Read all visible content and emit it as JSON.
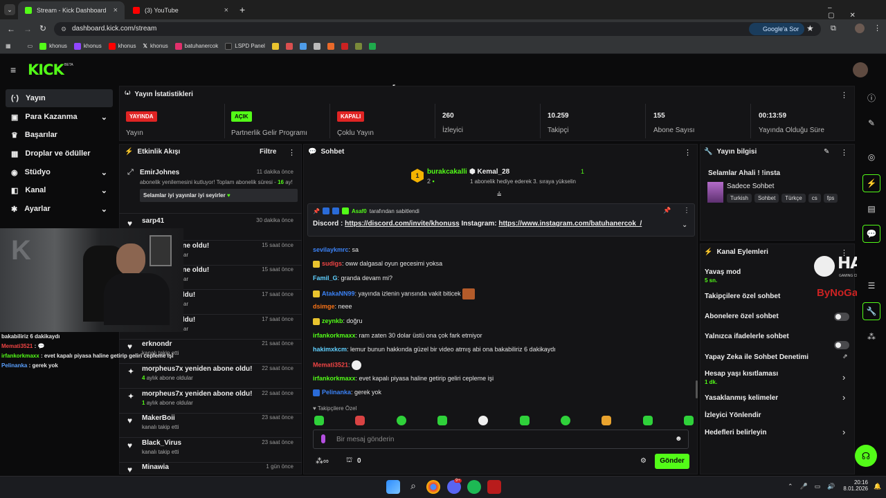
{
  "browser": {
    "tabs": [
      {
        "title": "Stream - Kick Dashboard"
      },
      {
        "title": "(3) YouTube"
      }
    ],
    "url": "dashboard.kick.com/stream",
    "google_btn": "Google'a Sor",
    "bookmarks": [
      "khonus",
      "khonus",
      "khonus",
      "khonus",
      "batuhanercok",
      "LSPD Panel"
    ]
  },
  "header": {
    "logo": "KICK",
    "beta": "BETA"
  },
  "sidebar": {
    "items": [
      {
        "label": "Yayın",
        "icon": "(·)"
      },
      {
        "label": "Para Kazanma",
        "icon": "▣"
      },
      {
        "label": "Başarılar",
        "icon": "♛"
      },
      {
        "label": "Droplar ve ödüller",
        "icon": "▦"
      },
      {
        "label": "Stüdyo",
        "icon": "◉"
      },
      {
        "label": "Kanal",
        "icon": "◧"
      },
      {
        "label": "Ayarlar",
        "icon": "✱"
      }
    ]
  },
  "stats": {
    "title": "Yayın İstatistikleri",
    "cells": [
      {
        "badge": "YAYINDA",
        "label": "Yayın"
      },
      {
        "badge": "AÇIK",
        "label": "Partnerlik Gelir Programı"
      },
      {
        "badge": "KAPALI",
        "label": "Çoklu Yayın"
      },
      {
        "value": "260",
        "label": "İzleyici"
      },
      {
        "value": "10.259",
        "label": "Takipçi"
      },
      {
        "value": "155",
        "label": "Abone Sayısı"
      },
      {
        "value": "00:13:59",
        "label": "Yayında Olduğu Süre"
      }
    ]
  },
  "feed": {
    "title": "Etkinlik Akışı",
    "filter": "Filtre",
    "first": {
      "name": "EmirJohnes",
      "time": "11 dakika önce",
      "text1": "abonelik yenilemesini kutluyor! Toplam abonelik süresi -",
      "months": "16",
      "text2": "ay!",
      "quote": "Selamlar iyi yayınlar iyi seyirler"
    },
    "items": [
      {
        "title": "sarp41",
        "sub": "",
        "time": "30 dakika önce"
      },
      {
        "title": "yeniden abone oldu!",
        "sub": "aylık abone oldular",
        "time": "15 saat önce"
      },
      {
        "title": "yeniden abone oldu!",
        "sub": "aylık abone oldular",
        "time": "15 saat önce"
      },
      {
        "title": "den abone oldu!",
        "sub": "aylık abone oldular",
        "time": "17 saat önce"
      },
      {
        "title": "den abone oldu!",
        "sub": "aylık abone oldular",
        "time": "17 saat önce"
      },
      {
        "title": "erknondr",
        "sub": "kanalı takip etti",
        "time": "21 saat önce"
      },
      {
        "title": "morpheus7x yeniden abone oldu!",
        "sub": "aylık abone oldular",
        "months": "4",
        "time": "22 saat önce"
      },
      {
        "title": "morpheus7x yeniden abone oldu!",
        "sub": "aylık abone oldular",
        "months": "1",
        "time": "22 saat önce"
      },
      {
        "title": "MakerBoii",
        "sub": "kanalı takip etti",
        "time": "23 saat önce"
      },
      {
        "title": "Black_Virus",
        "sub": "kanalı takip etti",
        "time": "23 saat önce"
      },
      {
        "title": "Minawia",
        "sub": "",
        "time": "1 gün önce"
      }
    ]
  },
  "overlay": {
    "lines": [
      {
        "user": "",
        "text": "bakabiliriz 6 dakikaydı"
      },
      {
        "user": "Memati3521",
        "text": ":"
      },
      {
        "user": "irfankorkmaxx",
        "text": ": evet kapalı piyasa haline getirip geliri cepleme işi"
      },
      {
        "user": "Pelinanka",
        "text": ": gerek yok"
      }
    ]
  },
  "chat": {
    "title": "Sohbet",
    "top1": {
      "name": "burakcakalli",
      "count": "2"
    },
    "top2": {
      "name": "Kemal_28",
      "count": "1",
      "note": "1 abonelik hediye ederek 3. sıraya yükselin"
    },
    "pinned": {
      "by": "Asaf0",
      "by_text": "tarafından sabitlendi",
      "label1": "Discord :",
      "link1": "https://discord.com/invite/khonuss",
      "label2": "Instagram:",
      "link2": "https://www.instagram.com/batuhanercok_/"
    },
    "messages": [
      {
        "user": "sevilaykmrc",
        "color": "#3b82f6",
        "text": ": sa"
      },
      {
        "user": "sudigs",
        "color": "#ef4444",
        "text": ": oww dalgasal oyun gecesimi yoksa"
      },
      {
        "user": "Famil_G",
        "color": "#60d0ff",
        "text": ": granda devam mi?"
      },
      {
        "user": "AtakaNN99",
        "color": "#3b82f6",
        "text": ": yayında izlenin yarısında vakit biticek"
      },
      {
        "user": "dsimge",
        "color": "#f97316",
        "text": ": neee"
      },
      {
        "user": "zeynkb",
        "color": "#53fc18",
        "text": ": doğru"
      },
      {
        "user": "irfankorkmaxx",
        "color": "#53fc18",
        "text": ": ram zaten 30 dolar üstü ona çok fark etmiyor"
      },
      {
        "user": "hakimxkcm",
        "color": "#60d0ff",
        "text": ": lemur bunun hakkında güzel bir video atmış abi ona bakabiliriz 6 dakikaydı"
      },
      {
        "user": "Memati3521",
        "color": "#ef4444",
        "text": ":"
      },
      {
        "user": "irfankorkmaxx",
        "color": "#53fc18",
        "text": ": evet kapalı piyasa haline getirip geliri cepleme işi"
      },
      {
        "user": "Pelinanka",
        "color": "#3b82f6",
        "text": ": gerek yok"
      }
    ],
    "followers_only": "Takipçilere Özel",
    "placeholder": "Bir mesaj gönderin",
    "points": "0",
    "send": "Gönder"
  },
  "info": {
    "title": "Yayın bilgisi",
    "stream_title": "Selamlar Ahali ! !insta",
    "category": "Sadece Sohbet",
    "tags": [
      "Turkish",
      "Sohbet",
      "Türkçe",
      "cs",
      "fps"
    ]
  },
  "actions": {
    "title": "Kanal Eylemleri",
    "slow": "Yavaş mod",
    "slow_val": "5 sn.",
    "followers": "Takipçilere özel sohbet",
    "subs": "Abonelere özel sohbet",
    "emotes": "Yalnızca ifadelerle sohbet",
    "ai": "Yapay Zeka ile Sohbet Denetimi",
    "age": "Hesap yaşı kısıtlaması",
    "age_val": "1 dk.",
    "banned": "Yasaklanmış kelimeler",
    "redirect": "İzleyici Yönlendir",
    "goals": "Hedefleri belirleyin"
  },
  "sponsor": {
    "brand": "HAWK",
    "sub": "GAMING CHAIR",
    "brand2": "ByNoGame"
  },
  "taskbar": {
    "time": "20:16",
    "date": "8.01.2026",
    "badge": "9+"
  }
}
